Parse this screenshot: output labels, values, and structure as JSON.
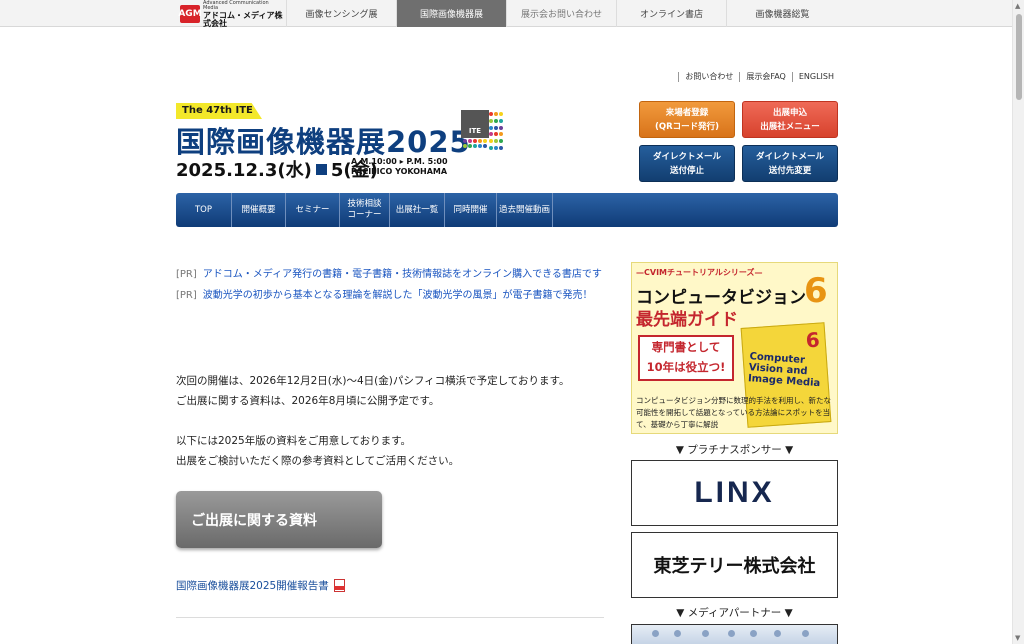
{
  "topbar": {
    "logo_mark": "AGM",
    "logo_sub": "Advanced Communication Media",
    "logo_main": "アドコム・メディア株式会社",
    "tabs": [
      {
        "label": "画像センシング展"
      },
      {
        "label": "国際画像機器展"
      },
      {
        "label": "展示会お問い合わせ"
      },
      {
        "label": "オンライン書店"
      },
      {
        "label": "画像機器総覧"
      }
    ]
  },
  "util_links": [
    "お問い合わせ",
    "展示会FAQ",
    "ENGLISH"
  ],
  "banner": {
    "edition": "The 47th ITE",
    "title": "国際画像機器展2025",
    "ite_label": "ITE",
    "date_start": "2025.12.3(水)",
    "date_end": "5(金)",
    "time": "A.M.10:00 ▸ P.M. 5:00",
    "venue": "PACIFICO YOKOHAMA"
  },
  "buttons": {
    "visitor_line1": "来場者登録",
    "visitor_line2": "(QRコード発行)",
    "exhibitor_line1": "出展申込",
    "exhibitor_line2": "出展社メニュー",
    "dm_stop_line1": "ダイレクトメール",
    "dm_stop_line2": "送付停止",
    "dm_change_line1": "ダイレクトメール",
    "dm_change_line2": "送付先変更"
  },
  "nav": [
    {
      "label": "TOP"
    },
    {
      "label": "開催概要"
    },
    {
      "label": "セミナー"
    },
    {
      "label": "技術相談\nコーナー"
    },
    {
      "label": "出展社一覧"
    },
    {
      "label": "同時開催"
    },
    {
      "label": "過去開催動画"
    }
  ],
  "pr": [
    {
      "tag": "[PR]",
      "text": "アドコム・メディア発行の書籍・電子書籍・技術情報誌をオンライン購入できる書店です"
    },
    {
      "tag": "[PR]",
      "text": "波動光学の初歩から基本となる理論を解説した「波動光学の風景」が電子書籍で発売！"
    }
  ],
  "content": {
    "line1": "次回の開催は、2026年12月2日(水)〜4日(金)パシフィコ横浜で予定しております。",
    "line2": "ご出展に関する資料は、2026年8月頃に公開予定です。",
    "line3": "以下には2025年版の資料をご用意しております。",
    "line4": "出展をご検討いただく際の参考資料としてご活用ください。",
    "materials_button": "ご出展に関する資料",
    "report_link": "国際画像機器展2025開催報告書"
  },
  "sidebar": {
    "ad": {
      "series": "—CVIMチュートリアルシリーズ—",
      "title1": "コンピュータビジョン",
      "number": "6",
      "title2": "最先端ガイド",
      "callout_line1": "専門書として",
      "callout_line2": "10年は役立つ!",
      "book_en": "Computer Vision and Image Media",
      "desc": "コンピュータビジョン分野に数理的手法を利用し、新たな可能性を開拓して話題となっている方法論にスポットを当て、基礎から丁寧に解説"
    },
    "platinum_heading": "▼ プラチナスポンサー ▼",
    "sponsor1": "LINX",
    "sponsor2": "東芝テリー株式会社",
    "media_heading": "▼ メディアパートナー ▼"
  }
}
